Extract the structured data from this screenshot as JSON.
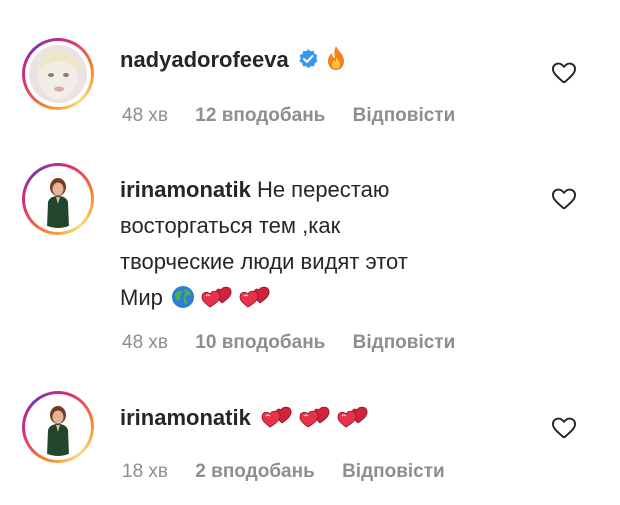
{
  "comments": [
    {
      "username": "nadyadorofeeva",
      "text": "",
      "verified": true,
      "time": "48 хв",
      "likes": "12 вподобань",
      "reply": "Відповісти",
      "icons": [
        "verified-badge-icon",
        "fire-emoji-icon"
      ]
    },
    {
      "username": "irinamonatik",
      "text_lines": [
        "Не перестаю",
        "восторгаться тем ,как",
        "творческие люди видят этот",
        "Мир"
      ],
      "time": "48 хв",
      "likes": "10 вподобань",
      "reply": "Відповісти",
      "icons": [
        "globe-emoji-icon",
        "two-hearts-emoji-icon",
        "two-hearts-emoji-icon"
      ]
    },
    {
      "username": "irinamonatik",
      "text": "",
      "time": "18 хв",
      "likes": "2 вподобань",
      "reply": "Відповісти",
      "icons": [
        "two-hearts-emoji-icon",
        "two-hearts-emoji-icon",
        "two-hearts-emoji-icon"
      ]
    }
  ],
  "colors": {
    "text": "#262626",
    "meta": "#8e8e8e",
    "verified": "#3897f0",
    "heart_emoji": "#d0243d"
  }
}
